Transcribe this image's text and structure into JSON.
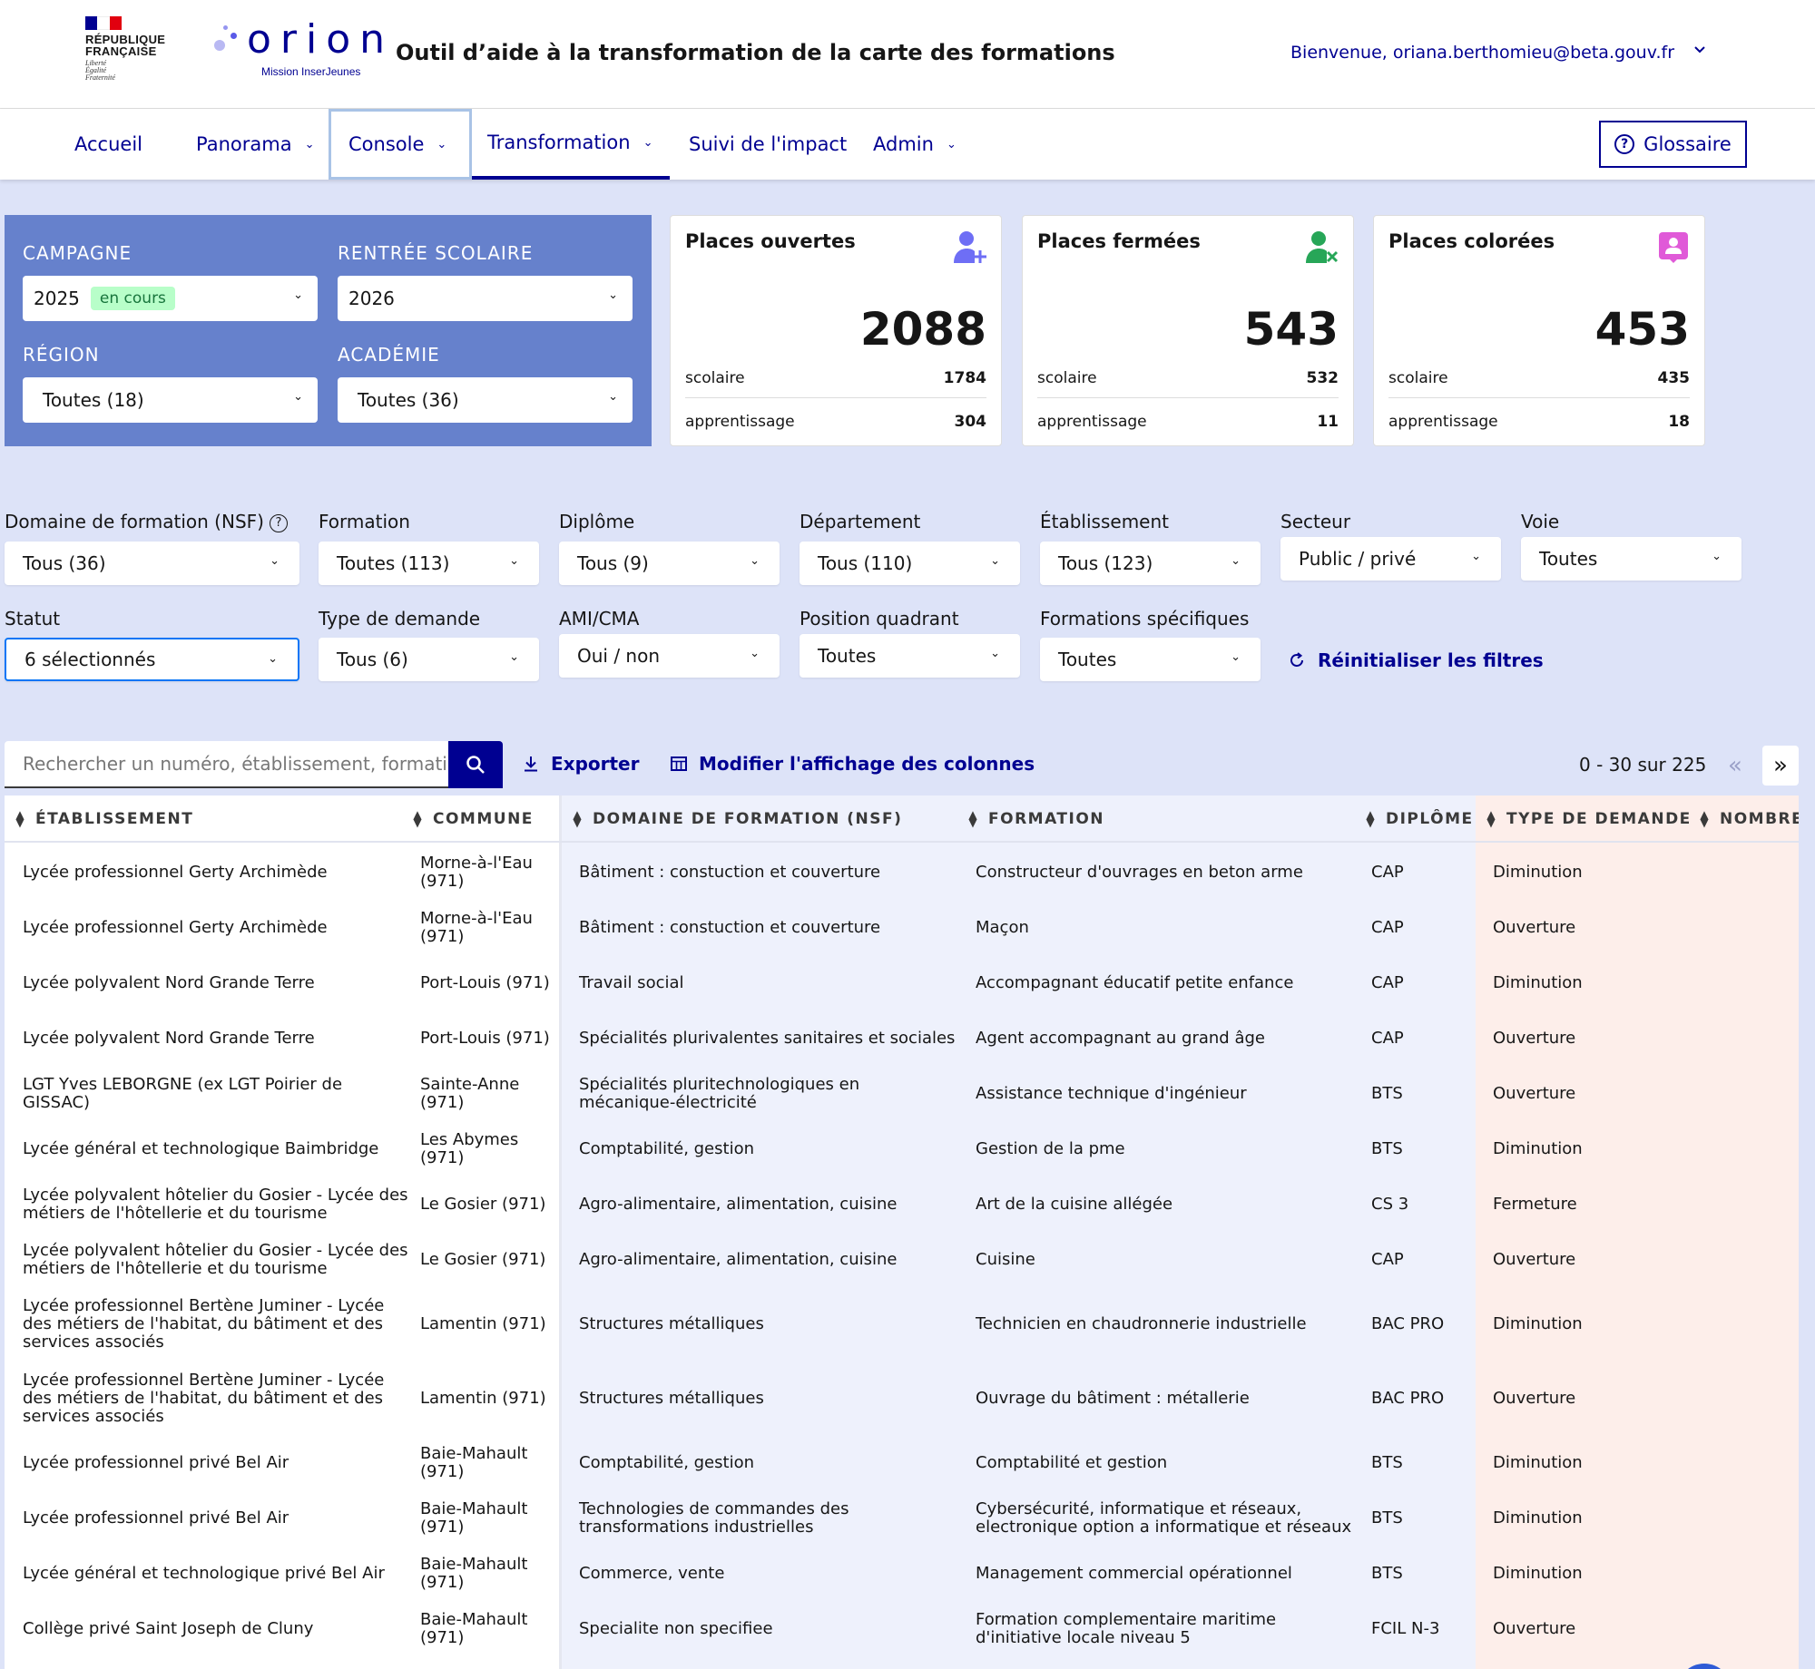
{
  "header": {
    "rf_lines": [
      "RÉPUBLIQUE",
      "FRANÇAISE"
    ],
    "rf_motto": [
      "Liberté",
      "Égalité",
      "Fraternité"
    ],
    "logo_word": "orion",
    "logo_sub": "Mission InserJeunes",
    "app_title": "Outil d’aide à la transformation de la carte des formations",
    "welcome": "Bienvenue, oriana.berthomieu@beta.gouv.fr"
  },
  "nav": {
    "items": [
      {
        "label": "Accueil"
      },
      {
        "label": "Panorama"
      },
      {
        "label": "Console"
      },
      {
        "label": "Transformation"
      },
      {
        "label": "Suivi de l'impact"
      },
      {
        "label": "Admin"
      }
    ],
    "glossary": "Glossaire"
  },
  "campaign": {
    "campagne_label": "CAMPAGNE",
    "campagne_value": "2025",
    "campagne_badge": "en cours",
    "rentree_label": "RENTRÉE SCOLAIRE",
    "rentree_value": "2026",
    "region_label": "RÉGION",
    "region_value": "Toutes (18)",
    "academie_label": "ACADÉMIE",
    "academie_value": "Toutes (36)"
  },
  "kpis": [
    {
      "title": "Places ouvertes",
      "value": "2088",
      "scolaire_label": "scolaire",
      "scolaire": "1784",
      "apprentissage_label": "apprentissage",
      "apprentissage": "304",
      "icon": "user-plus-icon",
      "color": "#6e6ef5"
    },
    {
      "title": "Places fermées",
      "value": "543",
      "scolaire_label": "scolaire",
      "scolaire": "532",
      "apprentissage_label": "apprentissage",
      "apprentissage": "11",
      "icon": "user-remove-icon",
      "color": "#27a658"
    },
    {
      "title": "Places colorées",
      "value": "453",
      "scolaire_label": "scolaire",
      "scolaire": "435",
      "apprentissage_label": "apprentissage",
      "apprentissage": "18",
      "icon": "user-badge-icon",
      "color": "#e05ad8"
    }
  ],
  "filters": {
    "nsf": {
      "label": "Domaine de formation (NSF)",
      "value": "Tous (36)"
    },
    "formation": {
      "label": "Formation",
      "value": "Toutes (113)"
    },
    "diplome": {
      "label": "Diplôme",
      "value": "Tous (9)"
    },
    "departement": {
      "label": "Département",
      "value": "Tous (110)"
    },
    "etablissement": {
      "label": "Établissement",
      "value": "Tous (123)"
    },
    "secteur": {
      "label": "Secteur",
      "value": "Public / privé"
    },
    "voie": {
      "label": "Voie",
      "value": "Toutes"
    },
    "statut": {
      "label": "Statut",
      "value": "6 sélectionnés"
    },
    "type_demande": {
      "label": "Type de demande",
      "value": "Tous (6)"
    },
    "ami_cma": {
      "label": "AMI/CMA",
      "value": "Oui / non"
    },
    "quadrant": {
      "label": "Position quadrant",
      "value": "Toutes"
    },
    "specifiques": {
      "label": "Formations spécifiques",
      "value": "Toutes"
    },
    "reset": "Réinitialiser les filtres"
  },
  "toolbar": {
    "search_placeholder": "Rechercher un numéro, établissement, formation...",
    "export": "Exporter",
    "columns": "Modifier l'affichage des colonnes",
    "pagination": "0 - 30 sur 225"
  },
  "table": {
    "headers": {
      "etablissement": "ÉTABLISSEMENT",
      "commune": "COMMUNE",
      "nsf": "DOMAINE DE FORMATION (NSF)",
      "formation": "FORMATION",
      "diplome": "DIPLÔME",
      "type": "TYPE DE DEMANDE",
      "nombre": "NOMBRE"
    },
    "rows": [
      {
        "etab": [
          "Lycée professionnel Gerty Archimède"
        ],
        "commune": [
          "Morne-à-l'Eau",
          "(971)"
        ],
        "nsf": [
          "Bâtiment : constuction et couverture"
        ],
        "formation": [
          "Constructeur d'ouvrages en beton arme"
        ],
        "diplome": "CAP",
        "type": "Diminution"
      },
      {
        "etab": [
          "Lycée professionnel Gerty Archimède"
        ],
        "commune": [
          "Morne-à-l'Eau",
          "(971)"
        ],
        "nsf": [
          "Bâtiment : constuction et couverture"
        ],
        "formation": [
          "Maçon"
        ],
        "diplome": "CAP",
        "type": "Ouverture"
      },
      {
        "etab": [
          "Lycée polyvalent Nord Grande Terre"
        ],
        "commune": [
          "Port-Louis (971)"
        ],
        "nsf": [
          "Travail social"
        ],
        "formation": [
          "Accompagnant éducatif petite enfance"
        ],
        "diplome": "CAP",
        "type": "Diminution"
      },
      {
        "etab": [
          "Lycée polyvalent Nord Grande Terre"
        ],
        "commune": [
          "Port-Louis (971)"
        ],
        "nsf": [
          "Spécialités plurivalentes sanitaires et sociales"
        ],
        "formation": [
          "Agent accompagnant au grand âge"
        ],
        "diplome": "CAP",
        "type": "Ouverture"
      },
      {
        "etab": [
          "LGT Yves LEBORGNE (ex LGT Poirier de",
          "GISSAC)"
        ],
        "commune": [
          "Sainte-Anne",
          "(971)"
        ],
        "nsf": [
          "Spécialités pluritechnologiques en",
          "mécanique-électricité"
        ],
        "formation": [
          "Assistance technique d'ingénieur"
        ],
        "diplome": "BTS",
        "type": "Ouverture"
      },
      {
        "etab": [
          "Lycée général et technologique Baimbridge"
        ],
        "commune": [
          "Les Abymes",
          "(971)"
        ],
        "nsf": [
          "Comptabilité, gestion"
        ],
        "formation": [
          "Gestion de la pme"
        ],
        "diplome": "BTS",
        "type": "Diminution"
      },
      {
        "etab": [
          "Lycée polyvalent hôtelier du Gosier - Lycée des",
          "métiers de l'hôtellerie et du tourisme"
        ],
        "commune": [
          "Le Gosier (971)"
        ],
        "nsf": [
          "Agro-alimentaire, alimentation, cuisine"
        ],
        "formation": [
          "Art de la cuisine allégée"
        ],
        "diplome": "CS 3",
        "type": "Fermeture"
      },
      {
        "etab": [
          "Lycée polyvalent hôtelier du Gosier - Lycée des",
          "métiers de l'hôtellerie et du tourisme"
        ],
        "commune": [
          "Le Gosier (971)"
        ],
        "nsf": [
          "Agro-alimentaire, alimentation, cuisine"
        ],
        "formation": [
          "Cuisine"
        ],
        "diplome": "CAP",
        "type": "Ouverture"
      },
      {
        "etab": [
          "Lycée professionnel Bertène Juminer - Lycée",
          "des métiers de l'habitat, du bâtiment et des",
          "services associés"
        ],
        "commune": [
          "Lamentin (971)"
        ],
        "nsf": [
          "Structures métalliques"
        ],
        "formation": [
          "Technicien en chaudronnerie industrielle"
        ],
        "diplome": "BAC PRO",
        "type": "Diminution"
      },
      {
        "etab": [
          "Lycée professionnel Bertène Juminer - Lycée",
          "des métiers de l'habitat, du bâtiment et des",
          "services associés"
        ],
        "commune": [
          "Lamentin (971)"
        ],
        "nsf": [
          "Structures métalliques"
        ],
        "formation": [
          "Ouvrage du bâtiment : métallerie"
        ],
        "diplome": "BAC PRO",
        "type": "Ouverture"
      },
      {
        "etab": [
          "Lycée professionnel privé Bel Air"
        ],
        "commune": [
          "Baie-Mahault",
          "(971)"
        ],
        "nsf": [
          "Comptabilité, gestion"
        ],
        "formation": [
          "Comptabilité et gestion"
        ],
        "diplome": "BTS",
        "type": "Diminution"
      },
      {
        "etab": [
          "Lycée professionnel privé Bel Air"
        ],
        "commune": [
          "Baie-Mahault",
          "(971)"
        ],
        "nsf": [
          "Technologies de commandes des",
          "transformations industrielles"
        ],
        "formation": [
          "Cybersécurité, informatique et réseaux,",
          "electronique option a informatique et réseaux"
        ],
        "diplome": "BTS",
        "type": "Diminution"
      },
      {
        "etab": [
          "Lycée général et technologique privé Bel Air"
        ],
        "commune": [
          "Baie-Mahault",
          "(971)"
        ],
        "nsf": [
          "Commerce, vente"
        ],
        "formation": [
          "Management commercial opérationnel"
        ],
        "diplome": "BTS",
        "type": "Diminution"
      },
      {
        "etab": [
          "Collège privé Saint Joseph de Cluny"
        ],
        "commune": [
          "Baie-Mahault",
          "(971)"
        ],
        "nsf": [
          "Specialite non specifiee"
        ],
        "formation": [
          "Formation complementaire maritime",
          "d'initiative locale niveau 5"
        ],
        "diplome": "FCIL N-3",
        "type": "Ouverture"
      }
    ]
  }
}
